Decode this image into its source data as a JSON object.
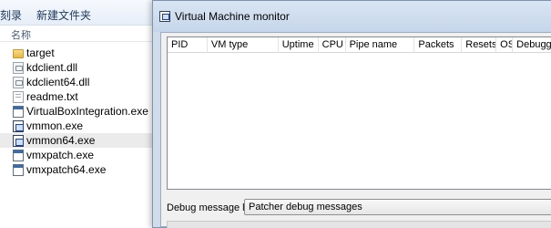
{
  "explorer": {
    "toolbar": {
      "burn_label": "刻录",
      "new_folder_label": "新建文件夹"
    },
    "column_header": "名称",
    "files": [
      {
        "name": "target",
        "icon": "folder-icon"
      },
      {
        "name": "kdclient.dll",
        "icon": "dll-file-icon"
      },
      {
        "name": "kdclient64.dll",
        "icon": "dll-file-icon"
      },
      {
        "name": "readme.txt",
        "icon": "text-file-icon"
      },
      {
        "name": "VirtualBoxIntegration.exe",
        "icon": "exe-file-icon"
      },
      {
        "name": "vmmon.exe",
        "icon": "monitor-exe-icon"
      },
      {
        "name": "vmmon64.exe",
        "icon": "monitor-exe-icon",
        "selected": true
      },
      {
        "name": "vmxpatch.exe",
        "icon": "exe-file-icon"
      },
      {
        "name": "vmxpatch64.exe",
        "icon": "exe-file-icon"
      }
    ]
  },
  "window": {
    "title": "Virtual Machine monitor",
    "columns": [
      "PID",
      "VM type",
      "Uptime",
      "CPU",
      "Pipe name",
      "Packets",
      "Resets",
      "OS",
      "Debugger"
    ],
    "debug_label": "Debug message level:",
    "debug_level": "Patcher debug messages"
  }
}
